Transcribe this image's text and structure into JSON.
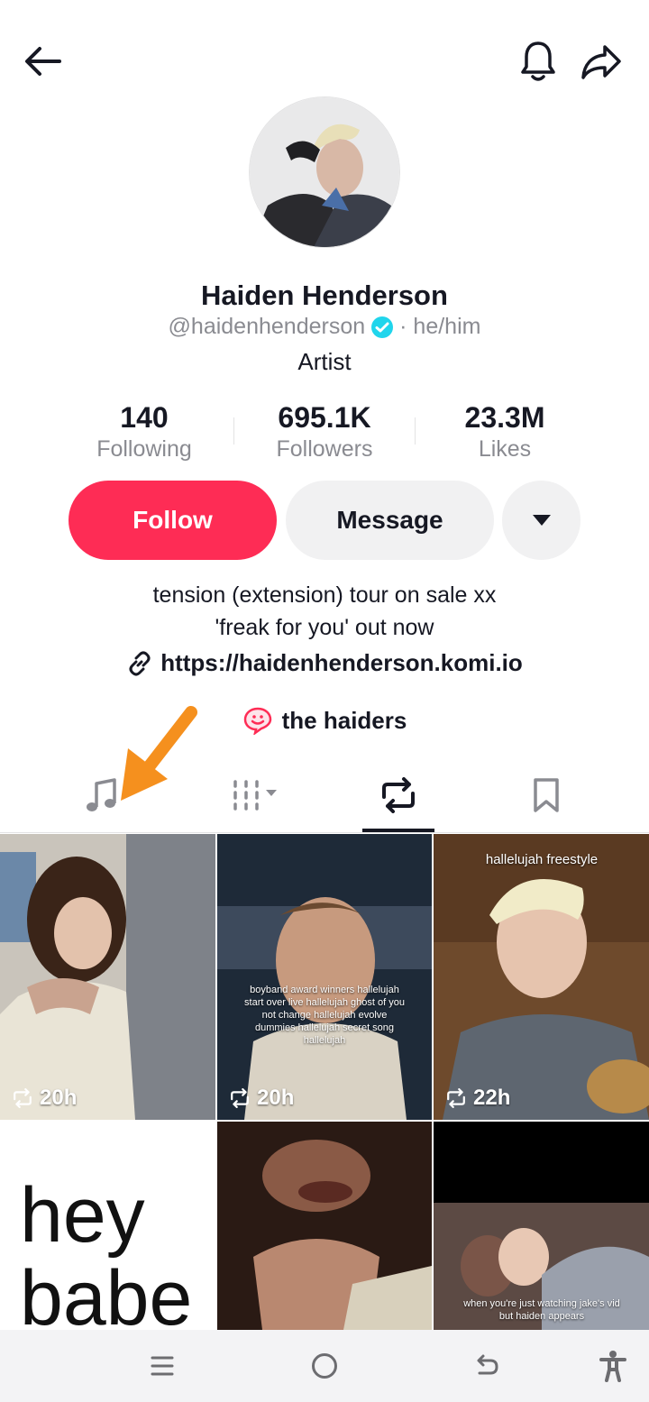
{
  "profile": {
    "name": "Haiden Henderson",
    "handle": "@haidenhenderson",
    "pronouns": "· he/him",
    "role": "Artist"
  },
  "stats": [
    {
      "value": "140",
      "label": "Following"
    },
    {
      "value": "695.1K",
      "label": "Followers"
    },
    {
      "value": "23.3M",
      "label": "Likes"
    }
  ],
  "actions": {
    "follow": "Follow",
    "message": "Message"
  },
  "bio": {
    "line1": "tension (extension) tour on sale xx",
    "line2": "'freak for you' out now",
    "link": "https://haidenhenderson.komi.io"
  },
  "fan_group": "the haiders",
  "grid": {
    "items": [
      {
        "time": "20h",
        "caption": ""
      },
      {
        "time": "20h",
        "caption": "boyband award winners hallelujah start over live hallelujah ghost of you not change hallelujah evolve dummies hallelujah secret song hallelujah"
      },
      {
        "time": "22h",
        "caption": "hallelujah freestyle"
      },
      {
        "time": "",
        "caption": "hey babe"
      },
      {
        "time": "",
        "caption": ""
      },
      {
        "time": "",
        "caption": "when you're just watching jake's vid but haiden appears"
      }
    ]
  },
  "colors": {
    "accent": "#fe2c55",
    "verified": "#20d5ec",
    "annotation_arrow": "#f5901e"
  }
}
